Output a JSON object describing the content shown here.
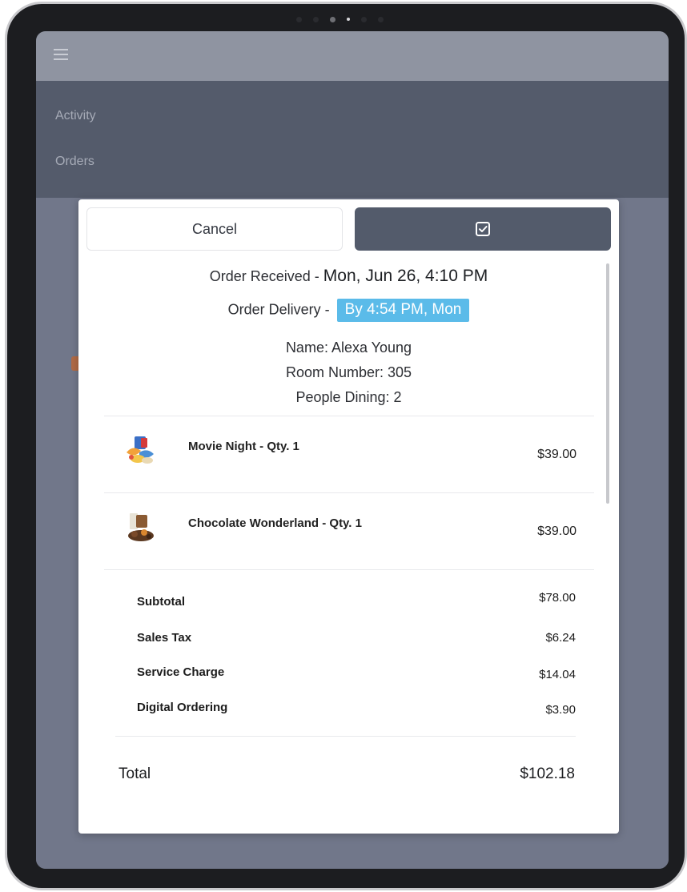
{
  "navigation": {
    "items": [
      {
        "label": "Activity"
      },
      {
        "label": "Orders"
      }
    ]
  },
  "modal": {
    "cancel_label": "Cancel",
    "confirm_icon": "checkbox-check-icon",
    "received_prefix": "Order Received - ",
    "received_value": "Mon, Jun 26, 4:10 PM",
    "delivery_prefix": "Order Delivery - ",
    "delivery_value": "By 4:54 PM, Mon",
    "name_line": "Name: Alexa Young",
    "room_line": "Room Number: 305",
    "people_line": "People Dining: 2",
    "items": [
      {
        "name": "Movie Night - Qty. 1",
        "price": "$39.00",
        "icon": "movie-night-thumbnail"
      },
      {
        "name": "Chocolate Wonderland - Qty. 1",
        "price": "$39.00",
        "icon": "chocolate-wonderland-thumbnail"
      }
    ],
    "summary": [
      {
        "label": "Subtotal",
        "value": "$78.00"
      },
      {
        "label": "Sales Tax",
        "value": "$6.24"
      },
      {
        "label": "Service Charge",
        "value": "$14.04"
      },
      {
        "label": "Digital Ordering",
        "value": "$3.90"
      }
    ],
    "total_label": "Total",
    "total_value": "$102.18"
  },
  "colors": {
    "accent_delivery": "#5bbbe9",
    "confirm_button": "#535b6b",
    "overlay": "#71778a"
  }
}
